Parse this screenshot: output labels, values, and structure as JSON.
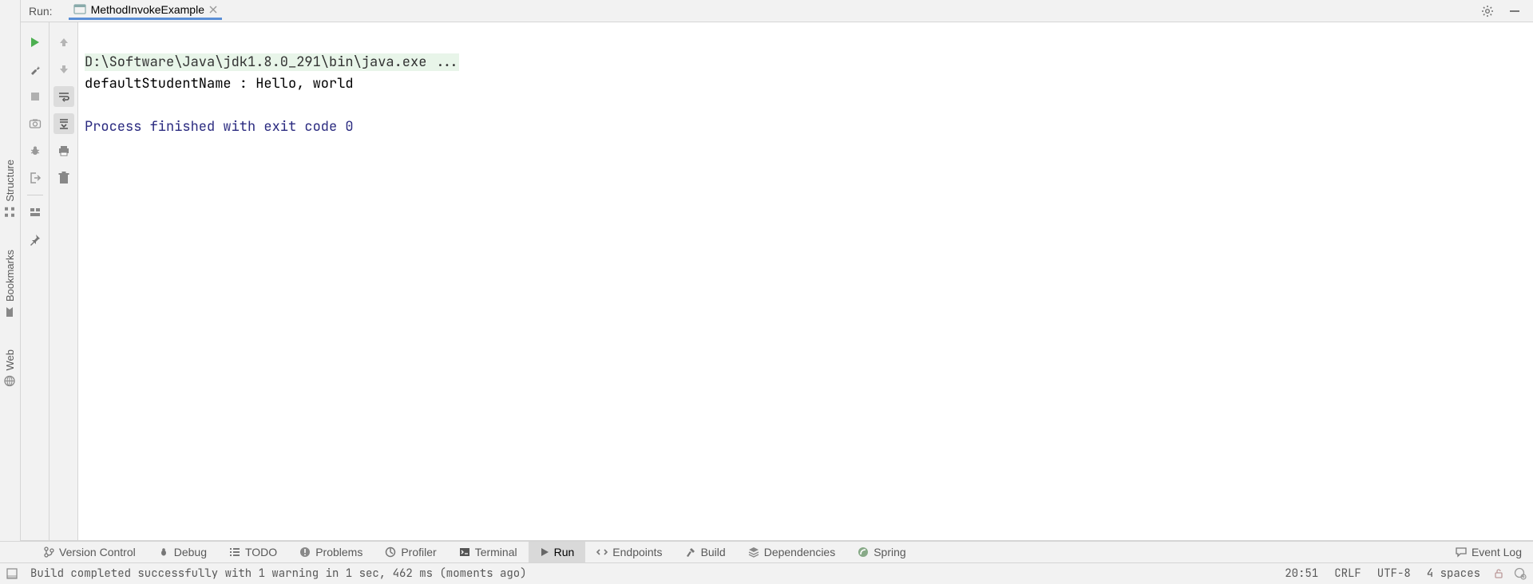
{
  "run_panel": {
    "label": "Run:",
    "tab_name": "MethodInvokeExample"
  },
  "console": {
    "command_line": "D:\\Software\\Java\\jdk1.8.0_291\\bin\\java.exe ...",
    "output_line": "defaultStudentName : Hello, world",
    "exit_line": "Process finished with exit code 0"
  },
  "left_strip": {
    "structure": "Structure",
    "bookmarks": "Bookmarks",
    "web": "Web"
  },
  "bottom_tabs": {
    "version_control": "Version Control",
    "debug": "Debug",
    "todo": "TODO",
    "problems": "Problems",
    "profiler": "Profiler",
    "terminal": "Terminal",
    "run": "Run",
    "endpoints": "Endpoints",
    "build": "Build",
    "dependencies": "Dependencies",
    "spring": "Spring",
    "event_log": "Event Log"
  },
  "status": {
    "build_msg": "Build completed successfully with 1 warning in 1 sec, 462 ms (moments ago)",
    "time": "20:51",
    "line_sep": "CRLF",
    "encoding": "UTF-8",
    "indent": "4 spaces"
  }
}
